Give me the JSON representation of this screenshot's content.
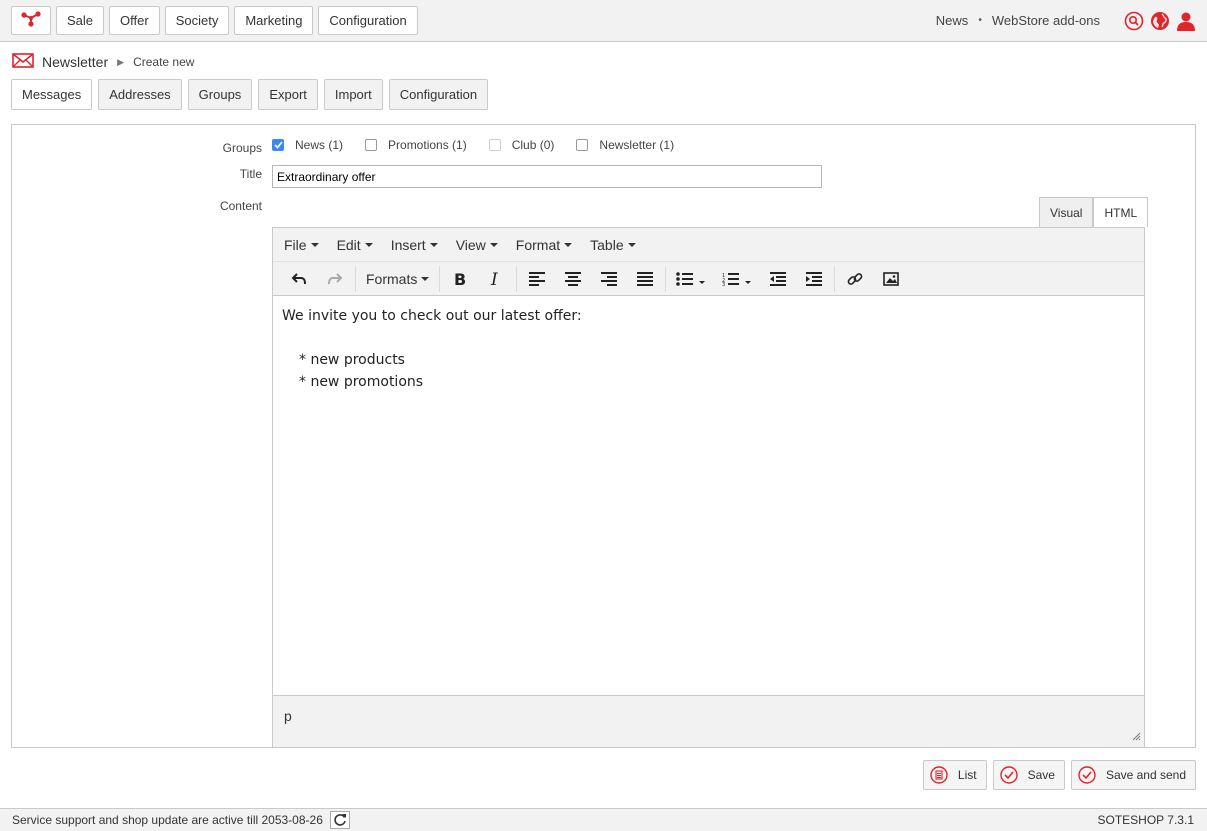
{
  "colors": {
    "accent": "#e0252b",
    "checkbox": "#3b88f5"
  },
  "topnav": {
    "logo_icon": "soteshop-logo-icon",
    "items": [
      "Sale",
      "Offer",
      "Society",
      "Marketing",
      "Configuration"
    ],
    "right_links": [
      "News",
      "WebStore add-ons"
    ],
    "separator": "•",
    "icons": [
      "search-icon",
      "globe-icon",
      "user-icon"
    ]
  },
  "breadcrumb": {
    "title": "Newsletter",
    "current": "Create new",
    "icon": "envelope-icon"
  },
  "subtabs": [
    "Messages",
    "Addresses",
    "Groups",
    "Export",
    "Import",
    "Configuration"
  ],
  "form": {
    "groups_label": "Groups",
    "groups": [
      {
        "label": "News (1)",
        "checked": true,
        "disabled": false
      },
      {
        "label": "Promotions (1)",
        "checked": false,
        "disabled": false
      },
      {
        "label": "Club (0)",
        "checked": false,
        "disabled": true
      },
      {
        "label": "Newsletter (1)",
        "checked": false,
        "disabled": false
      }
    ],
    "title_label": "Title",
    "title_value": "Extraordinary offer",
    "content_label": "Content"
  },
  "editor": {
    "mode_tabs": [
      "Visual",
      "HTML"
    ],
    "active_mode": "Visual",
    "menu": [
      "File",
      "Edit",
      "Insert",
      "View",
      "Format",
      "Table"
    ],
    "formats_label": "Formats",
    "content": {
      "intro": "We invite you to check out our latest offer:",
      "items": [
        "* new products",
        "* new promotions"
      ]
    },
    "path": "p"
  },
  "actions": [
    "List",
    "Save",
    "Save and send"
  ],
  "footer": {
    "support_text": "Service support and shop update are active till 2053-08-26",
    "version": "SOTESHOP 7.3.1"
  }
}
